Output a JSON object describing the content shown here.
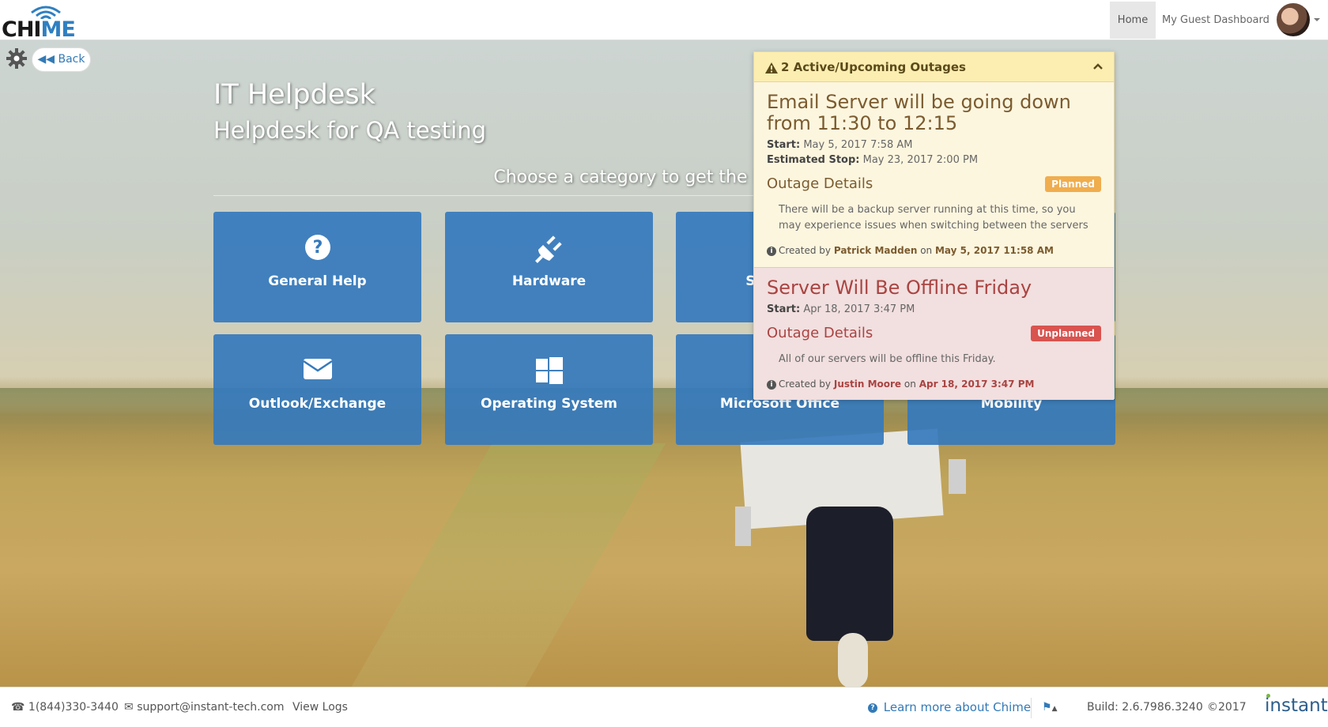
{
  "app": {
    "logo_text_a": "CHI",
    "logo_text_b": "ME"
  },
  "nav": {
    "home": "Home",
    "guest_dashboard": "My Guest Dashboard"
  },
  "controls": {
    "back": "Back"
  },
  "header": {
    "title": "IT Helpdesk",
    "subtitle": "Helpdesk for QA testing",
    "prompt": "Choose a category to get the best help"
  },
  "categories": [
    {
      "label": "General Help",
      "icon": "question-circle-icon"
    },
    {
      "label": "Hardware",
      "icon": "plug-icon"
    },
    {
      "label": "Software",
      "icon": "software-icon"
    },
    {
      "label": "Outlook/Exchange",
      "icon": "envelope-icon"
    },
    {
      "label": "Operating System",
      "icon": "windows-icon"
    },
    {
      "label": "Microsoft Office",
      "icon": "office-icon"
    },
    {
      "label": "Mobility",
      "icon": "mobile-icon"
    }
  ],
  "outages": {
    "heading": "2 Active/Upcoming Outages",
    "items": [
      {
        "title": "Email Server will be going down from 11:30 to 12:15",
        "start_label": "Start:",
        "start": "May 5, 2017 7:58 AM",
        "stop_label": "Estimated Stop:",
        "stop": "May 23, 2017 2:00 PM",
        "details_label": "Outage Details",
        "badge": "Planned",
        "description": "There will be a backup server running at this time, so you may experience issues when switching between the servers",
        "created_prefix": "Created by",
        "created_by": "Patrick Madden",
        "created_on_word": "on",
        "created_on": "May 5, 2017 11:58 AM"
      },
      {
        "title": "Server Will Be Offline Friday",
        "start_label": "Start:",
        "start": "Apr 18, 2017 3:47 PM",
        "details_label": "Outage Details",
        "badge": "Unplanned",
        "description": "All of our servers will be offline this Friday.",
        "created_prefix": "Created by",
        "created_by": "Justin Moore",
        "created_on_word": "on",
        "created_on": "Apr 18, 2017 3:47 PM"
      }
    ]
  },
  "footer": {
    "phone": "1(844)330-3440",
    "email": "support@instant-tech.com",
    "view_logs": "View Logs",
    "learn_more": "Learn more about Chime",
    "build": "Build: 2.6.7986.3240",
    "copyright": "©2017",
    "brand": "instant"
  },
  "colors": {
    "tile": "#357abd",
    "planned": "#f0ad4e",
    "unplanned": "#d9534f",
    "link": "#337ab7"
  }
}
